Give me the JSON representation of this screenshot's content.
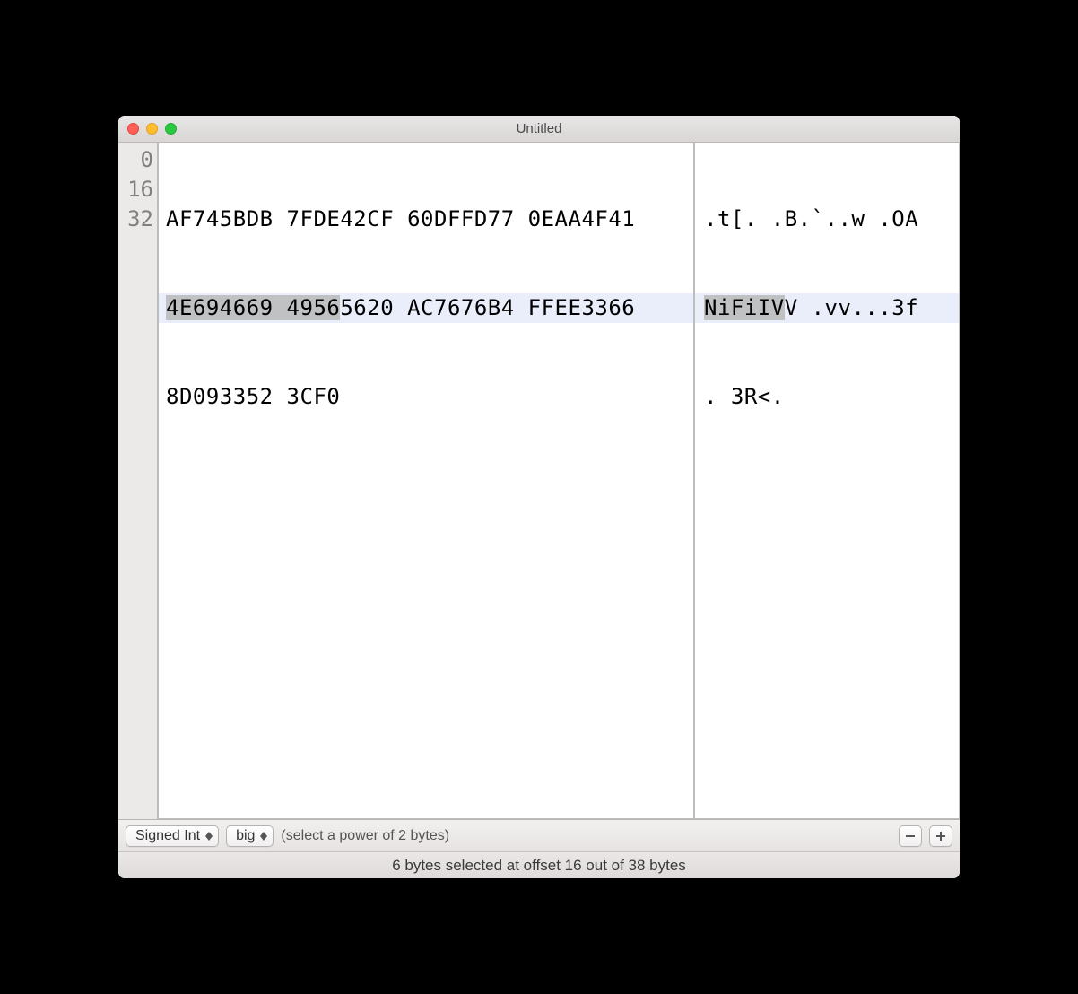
{
  "window": {
    "title": "Untitled"
  },
  "offsets": [
    "0",
    "16",
    "32"
  ],
  "hex_rows": [
    {
      "groups": [
        "AF745BDB",
        "7FDE42CF",
        "60DFFD77",
        "0EAA4F41"
      ],
      "selected_groups": []
    },
    {
      "groups": [
        "4E694669",
        "49565620",
        "AC7676B4",
        "FFEE3366"
      ],
      "selected_groups": [
        0,
        1
      ],
      "row_highlight": true,
      "sel_partial_in_group1": 4
    },
    {
      "groups": [
        "8D093352",
        "3CF0"
      ],
      "selected_groups": []
    }
  ],
  "ascii_rows": [
    {
      "text": ".t[. .B.`..w .OA"
    },
    {
      "text_parts": {
        "dark": "NiFiIV",
        "rest": "V .vv...3f"
      },
      "row_highlight": true
    },
    {
      "text": ". 3R<."
    }
  ],
  "toolbar": {
    "type_select": "Signed Int",
    "endian_select": "big",
    "hint": "(select a power of 2 bytes)"
  },
  "status": "6 bytes selected at offset 16 out of 38 bytes"
}
